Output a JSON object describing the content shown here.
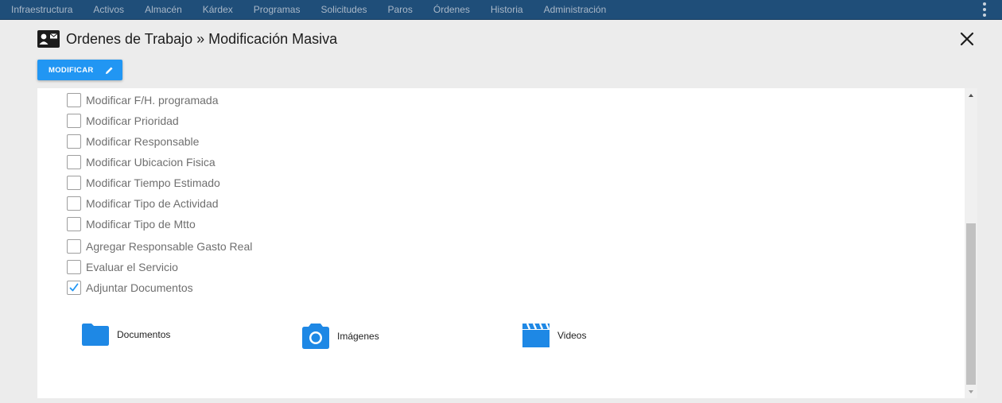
{
  "topnav": {
    "items": [
      "Infraestructura",
      "Activos",
      "Almacén",
      "Kárdex",
      "Programas",
      "Solicitudes",
      "Paros",
      "Órdenes",
      "Historia",
      "Administración"
    ],
    "more_icon": "kebab-vertical-icon"
  },
  "header": {
    "title": "Ordenes de Trabajo » Modificación Masiva",
    "title_icon": "id-card-icon",
    "close_icon": "close-icon"
  },
  "toolbar": {
    "modificar_label": "MODIFICAR",
    "modificar_icon": "pencil-icon"
  },
  "options": [
    {
      "label": "Modificar F/H. programada",
      "checked": false
    },
    {
      "label": "Modificar Prioridad",
      "checked": false
    },
    {
      "label": "Modificar Responsable",
      "checked": false
    },
    {
      "label": "Modificar Ubicacion Fisica",
      "checked": false
    },
    {
      "label": "Modificar Tiempo Estimado",
      "checked": false
    },
    {
      "label": "Modificar Tipo de Actividad",
      "checked": false
    },
    {
      "label": "Modificar Tipo de Mtto",
      "checked": false
    },
    {
      "label": "Agregar Responsable Gasto Real",
      "checked": false
    },
    {
      "label": "Evaluar el Servicio",
      "checked": false
    },
    {
      "label": "Adjuntar Documentos",
      "checked": true
    }
  ],
  "attachments": [
    {
      "label": "Documentos",
      "icon": "folder-icon"
    },
    {
      "label": "Imágenes",
      "icon": "camera-icon"
    },
    {
      "label": "Videos",
      "icon": "clapperboard-icon"
    }
  ],
  "colors": {
    "nav_bg": "#1f4e79",
    "accent": "#2196f3",
    "panel_bg": "#ffffff",
    "page_bg": "#ececec"
  }
}
